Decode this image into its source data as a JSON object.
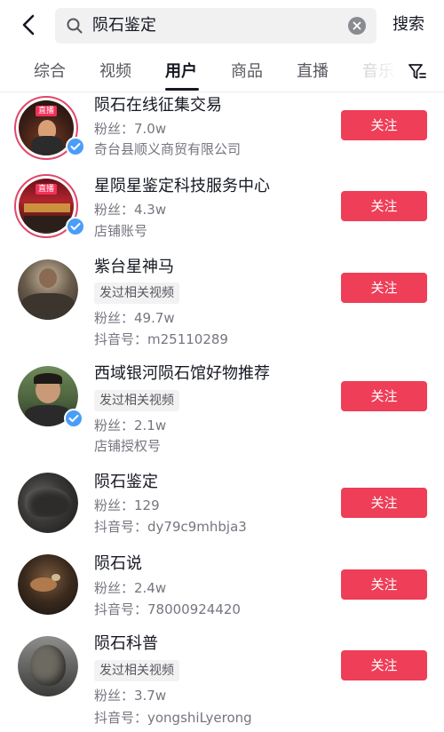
{
  "header": {
    "back_icon": "chevron-left-icon",
    "search_query": "陨石鉴定",
    "search_button": "搜索"
  },
  "tabs": [
    {
      "label": "综合"
    },
    {
      "label": "视频"
    },
    {
      "label": "用户",
      "active": true
    },
    {
      "label": "商品"
    },
    {
      "label": "直播"
    },
    {
      "label": "音乐"
    }
  ],
  "colors": {
    "accent_red": "#ee3e58",
    "verified_blue": "#4a9df8",
    "live_border": "#e0486a"
  },
  "users": [
    {
      "name": "陨石在线征集交易",
      "fans": "粉丝：7.0w",
      "sub": "奇台县顺义商贸有限公司",
      "live_tag": "直播",
      "verified": true,
      "follow": "关注"
    },
    {
      "name": "星陨星鉴定科技服务中心",
      "fans": "粉丝：4.3w",
      "sub": "店铺账号",
      "live_tag": "直播",
      "verified": true,
      "follow": "关注"
    },
    {
      "name": "紫台星神马",
      "tag": "发过相关视频",
      "fans": "粉丝：49.7w",
      "sub": "抖音号：m25110289",
      "verified": false,
      "follow": "关注"
    },
    {
      "name": "西域银河陨石馆好物推荐",
      "tag": "发过相关视频",
      "fans": "粉丝：2.1w",
      "sub": "店铺授权号",
      "verified": true,
      "follow": "关注"
    },
    {
      "name": "陨石鉴定",
      "fans": "粉丝：129",
      "sub": "抖音号：dy79c9mhbja3",
      "verified": false,
      "follow": "关注"
    },
    {
      "name": "陨石说",
      "fans": "粉丝：2.4w",
      "sub": "抖音号：78000924420",
      "verified": false,
      "follow": "关注"
    },
    {
      "name": "陨石科普",
      "tag": "发过相关视频",
      "fans": "粉丝：3.7w",
      "sub": "抖音号：yongshiLyerong",
      "verified": false,
      "follow": "关注"
    }
  ]
}
